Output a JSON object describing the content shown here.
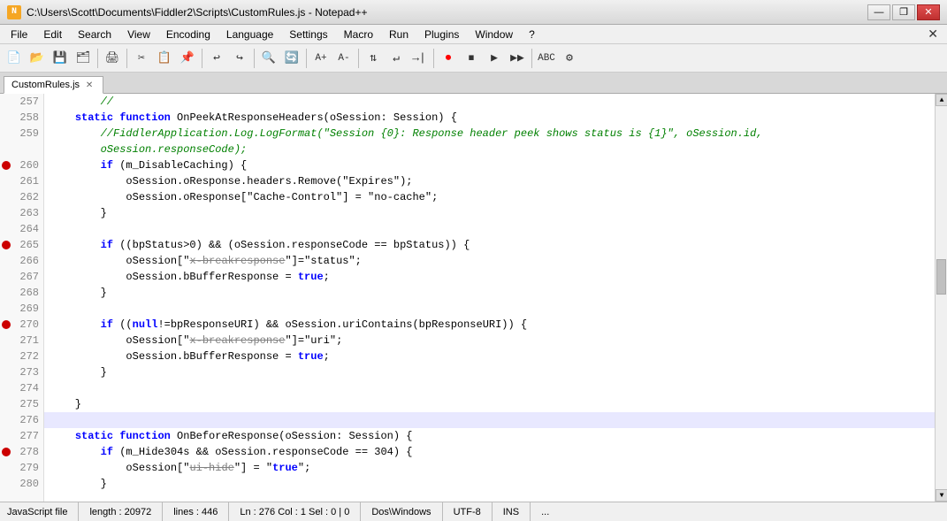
{
  "window": {
    "title": "C:\\Users\\Scott\\Documents\\Fiddler2\\Scripts\\CustomRules.js - Notepad++",
    "app_icon": "N",
    "minimize": "—",
    "restore": "❐",
    "close": "✕"
  },
  "menu": {
    "items": [
      "File",
      "Edit",
      "Search",
      "View",
      "Encoding",
      "Language",
      "Settings",
      "Macro",
      "Run",
      "Plugins",
      "Window",
      "?"
    ],
    "close_x": "✕"
  },
  "tab": {
    "name": "CustomRules.js",
    "close": "✕"
  },
  "status": {
    "file_type": "JavaScript file",
    "length": "length : 20972",
    "lines": "lines : 446",
    "position": "Ln : 276   Col : 1   Sel : 0 | 0",
    "line_ending": "Dos\\Windows",
    "encoding": "UTF-8",
    "insert_mode": "INS",
    "extra": "..."
  },
  "code": {
    "lines": [
      {
        "num": 257,
        "bp": false,
        "content": "        //",
        "highlighted": false
      },
      {
        "num": 258,
        "bp": false,
        "content": "    static function OnPeekAtResponseHeaders(oSession: Session) {",
        "highlighted": false
      },
      {
        "num": 259,
        "bp": false,
        "content": "        //FiddlerApplication.Log.LogFormat(\"Session {0}: Response header peek shows status is {1}\", oSession.id,",
        "highlighted": false,
        "is_comment": true
      },
      {
        "num": "",
        "bp": false,
        "content": "        oSession.responseCode);",
        "highlighted": false,
        "continuation": true
      },
      {
        "num": 260,
        "bp": true,
        "content": "        if (m_DisableCaching) {",
        "highlighted": false
      },
      {
        "num": 261,
        "bp": false,
        "content": "            oSession.oResponse.headers.Remove(\"Expires\");",
        "highlighted": false
      },
      {
        "num": 262,
        "bp": false,
        "content": "            oSession.oResponse[\"Cache-Control\"] = \"no-cache\";",
        "highlighted": false
      },
      {
        "num": 263,
        "bp": false,
        "content": "        }",
        "highlighted": false
      },
      {
        "num": 264,
        "bp": false,
        "content": "",
        "highlighted": false
      },
      {
        "num": 265,
        "bp": true,
        "content": "        if ((bpStatus>0) && (oSession.responseCode == bpStatus)) {",
        "highlighted": false
      },
      {
        "num": 266,
        "bp": false,
        "content": "            oSession[\"x-breakresponse\"]=\"status\";",
        "highlighted": false,
        "has_strike": true
      },
      {
        "num": 267,
        "bp": false,
        "content": "            oSession.bBufferResponse = true;",
        "highlighted": false
      },
      {
        "num": 268,
        "bp": false,
        "content": "        }",
        "highlighted": false
      },
      {
        "num": 269,
        "bp": false,
        "content": "",
        "highlighted": false
      },
      {
        "num": 270,
        "bp": true,
        "content": "        if ((null!=bpResponseURI) && oSession.uriContains(bpResponseURI)) {",
        "highlighted": false
      },
      {
        "num": 271,
        "bp": false,
        "content": "            oSession[\"x-breakresponse\"]=\"uri\";",
        "highlighted": false,
        "has_strike2": true
      },
      {
        "num": 272,
        "bp": false,
        "content": "            oSession.bBufferResponse = true;",
        "highlighted": false
      },
      {
        "num": 273,
        "bp": false,
        "content": "        }",
        "highlighted": false
      },
      {
        "num": 274,
        "bp": false,
        "content": "",
        "highlighted": false
      },
      {
        "num": 275,
        "bp": false,
        "content": "    }",
        "highlighted": false
      },
      {
        "num": 276,
        "bp": false,
        "content": "",
        "highlighted": true
      },
      {
        "num": 277,
        "bp": false,
        "content": "    static function OnBeforeResponse(oSession: Session) {",
        "highlighted": false
      },
      {
        "num": 278,
        "bp": true,
        "content": "        if (m_Hide304s && oSession.responseCode == 304) {",
        "highlighted": false
      },
      {
        "num": 279,
        "bp": false,
        "content": "            oSession[\"ui-hide\"] = \"true\";",
        "highlighted": false,
        "has_strike3": true
      },
      {
        "num": 280,
        "bp": false,
        "content": "        }",
        "highlighted": false
      }
    ]
  }
}
